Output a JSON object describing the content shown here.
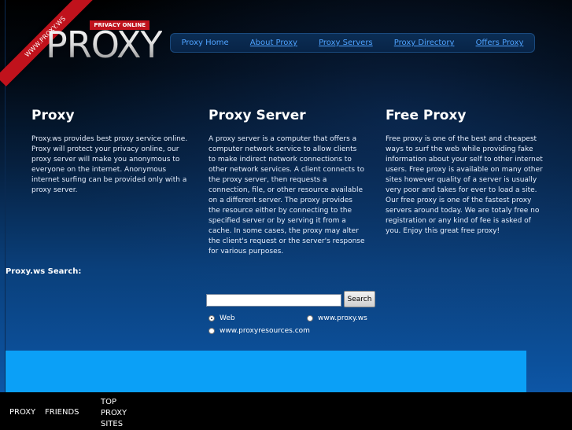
{
  "brand": {
    "ribbon_text": "WWW.PROXY.WS",
    "logo_word": "PROXY",
    "logo_tag": "PRIVACY ONLINE"
  },
  "nav": {
    "items": [
      {
        "label": "Proxy Home"
      },
      {
        "label": "About Proxy"
      },
      {
        "label": "Proxy Servers"
      },
      {
        "label": "Proxy Directory"
      },
      {
        "label": "Offers Proxy"
      }
    ]
  },
  "columns": [
    {
      "title": "Proxy",
      "text": "Proxy.ws provides best proxy service online. Proxy will protect your privacy online, our proxy server will make you anonymous to everyone on the internet. Anonymous internet surfing can be provided only with a proxy server."
    },
    {
      "title": "Proxy Server",
      "text": "A proxy server is a computer that offers a computer network service to allow clients to make indirect network connections to other network services. A client connects to the proxy server, then requests a connection, file, or other resource available on a different server. The proxy provides the resource either by connecting to the specified server or by serving it from a cache. In some cases, the proxy may alter the client's request or the server's response for various purposes."
    },
    {
      "title": "Free Proxy",
      "text": "Free proxy is one of the best and cheapest ways to surf the web while providing fake information about your self to other internet users. Free proxy is available on many other sites however quality of a server is usually very poor and takes for ever to load a site. Our free proxy is one of the fastest proxy servers around today. We are totaly free no registration or any kind of fee is asked of you. Enjoy this great free proxy!"
    }
  ],
  "search": {
    "title": "Proxy.ws Search:",
    "input_value": "",
    "button_label": "Search",
    "options": [
      {
        "label": "Web",
        "checked": true
      },
      {
        "label": "www.proxy.ws",
        "checked": false
      },
      {
        "label": "www.proxyresources.com",
        "checked": false
      }
    ]
  },
  "footer": {
    "items": [
      "PROXY",
      "FRIENDS",
      "TOP PROXY SITES"
    ]
  },
  "colors": {
    "accent_red": "#c0121c",
    "link_blue": "#4fa3ff",
    "panel_blue": "#0ba0f7"
  }
}
